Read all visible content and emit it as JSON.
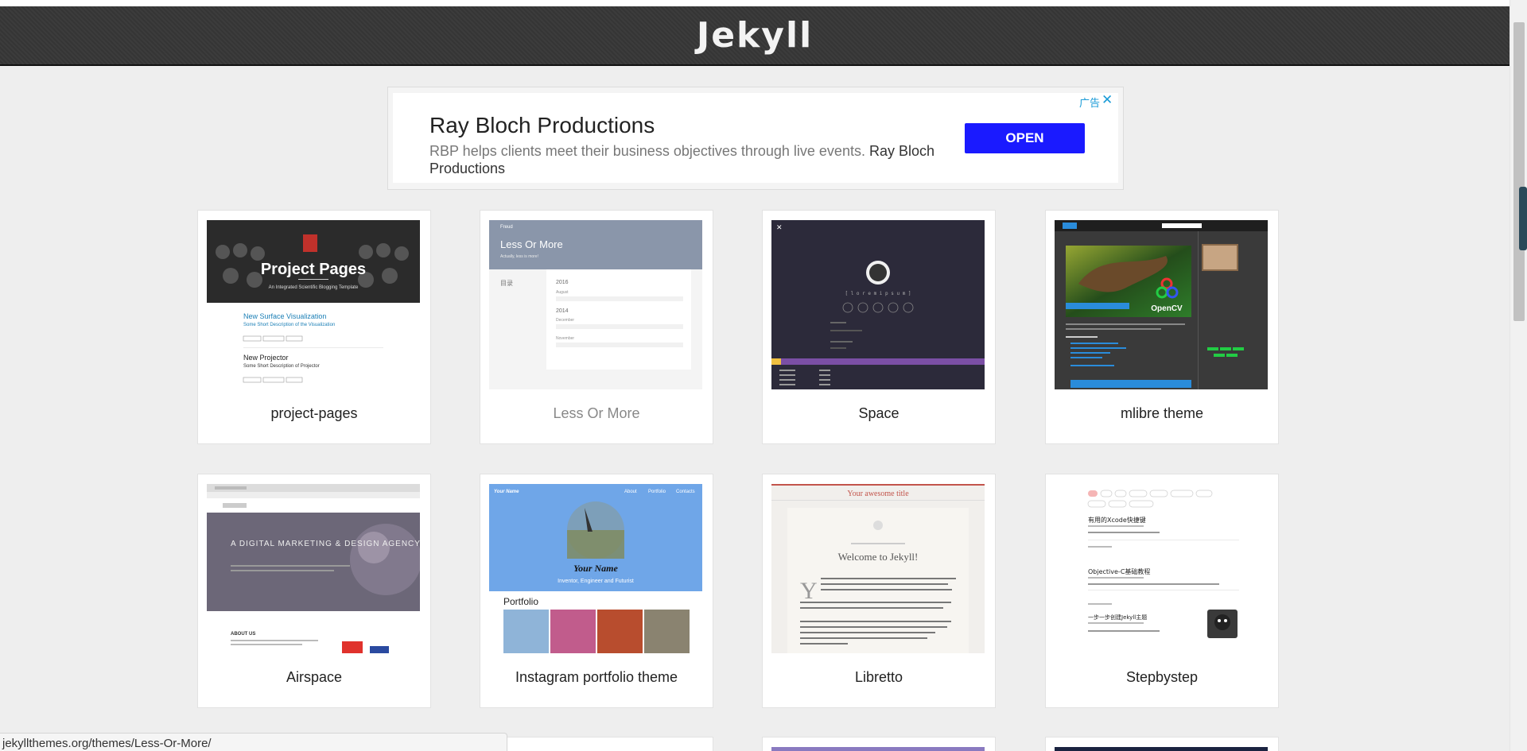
{
  "site": {
    "title": "Jekyll"
  },
  "ad": {
    "title": "Ray Bloch Productions",
    "desc_main": "RBP helps clients meet their business objectives through live events.",
    "desc_brand": "Ray Bloch Productions",
    "open_label": "OPEN",
    "ad_label": "广告",
    "close_glyph": "✕"
  },
  "themes": [
    {
      "name": "project-pages",
      "thumb_title": "Project Pages",
      "thumb_sub": "An Integrated Scientific Blogging Template",
      "post1": "New Surface Visualization",
      "post1_sub": "Some Short Description of the Visualization",
      "post2": "New Projector",
      "post2_sub": "Some Short Description of Projector"
    },
    {
      "name": "Less Or More",
      "thumb_title": "Less Or More",
      "thumb_sub": "Actually, less is more!",
      "brand": "Freud",
      "side": "目录",
      "years": [
        "2016",
        "August",
        "2014",
        "December",
        "November"
      ]
    },
    {
      "name": "Space",
      "thumb_title": "[ l o r e m   i p s u m ]"
    },
    {
      "name": "mlibre theme",
      "thumb_title": "OpenCV"
    },
    {
      "name": "Airspace",
      "thumb_title": "A DIGITAL MARKETING & DESIGN AGENCY",
      "thumb_sub": "ABOUT US"
    },
    {
      "name": "Instagram portfolio theme",
      "thumb_title": "Your Name",
      "thumb_sub": "Inventor, Engineer and Futurist",
      "nav": [
        "About",
        "Portfolio",
        "Contacts"
      ],
      "section": "Portfolio",
      "brand": "Your Name"
    },
    {
      "name": "Libretto",
      "thumb_title": "Your awesome title",
      "thumb_sub": "Welcome to Jekyll!"
    },
    {
      "name": "Stepbystep",
      "thumb_title": "有用的Xcode快捷键",
      "thumb_sub": "Objective-C基础教程",
      "post3": "一步一步创建Jekyll主题"
    }
  ],
  "status_url": "jekyllthemes.org/themes/Less-Or-More/"
}
